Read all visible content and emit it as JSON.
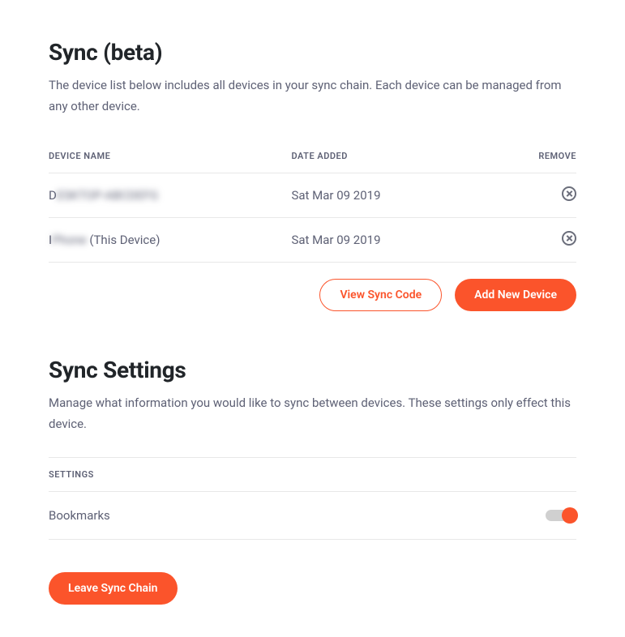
{
  "sync": {
    "title": "Sync (beta)",
    "description": "The device list below includes all devices in your sync chain. Each device can be managed from any other device.",
    "columns": {
      "name": "DEVICE NAME",
      "date": "DATE ADDED",
      "remove": "REMOVE"
    },
    "devices": [
      {
        "name_prefix": "D",
        "name_blur": "ESKTOP-ABCDEFG",
        "suffix": "",
        "date": "Sat Mar 09 2019"
      },
      {
        "name_prefix": "I",
        "name_blur": "Phone",
        "suffix": " (This Device)",
        "date": "Sat Mar 09 2019"
      }
    ],
    "buttons": {
      "view_code": "View Sync Code",
      "add_device": "Add New Device"
    }
  },
  "settings": {
    "title": "Sync Settings",
    "description": "Manage what information you would like to sync between devices. These settings only effect this device.",
    "column_header": "SETTINGS",
    "items": [
      {
        "label": "Bookmarks",
        "enabled": true
      }
    ],
    "leave_button": "Leave Sync Chain"
  }
}
